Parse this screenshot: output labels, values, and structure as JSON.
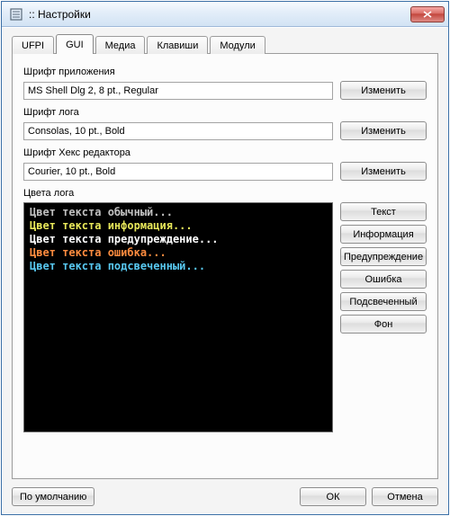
{
  "window": {
    "title": ":: Настройки"
  },
  "tabs": [
    {
      "label": "UFPI"
    },
    {
      "label": "GUI"
    },
    {
      "label": "Медиа"
    },
    {
      "label": "Клавиши"
    },
    {
      "label": "Модули"
    }
  ],
  "gui": {
    "app_font_label": "Шрифт приложения",
    "app_font_value": "MS Shell Dlg 2, 8 pt., Regular",
    "log_font_label": "Шрифт лога",
    "log_font_value": "Consolas, 10 pt., Bold",
    "hex_font_label": "Шрифт Хекс редактора",
    "hex_font_value": "Courier, 10 pt., Bold",
    "change_button": "Изменить",
    "log_colors_label": "Цвета лога",
    "console": {
      "normal": "Цвет текста обычный...",
      "info": "Цвет текста информация...",
      "warn": "Цвет текста предупреждение...",
      "error": "Цвет текста ошибка...",
      "highlight": "Цвет текста подсвеченный..."
    },
    "color_buttons": {
      "text": "Текст",
      "info": "Информация",
      "warn": "Предупреждение",
      "error": "Ошибка",
      "highlight": "Подсвеченный",
      "background": "Фон"
    }
  },
  "footer": {
    "defaults": "По умолчанию",
    "ok": "ОК",
    "cancel": "Отмена"
  },
  "colors": {
    "console_normal": "#c0c0c0",
    "console_info": "#e8e85a",
    "console_warn": "#ffffff",
    "console_error": "#ff8c3f",
    "console_highlight": "#58c8f0",
    "console_bg": "#000000"
  }
}
